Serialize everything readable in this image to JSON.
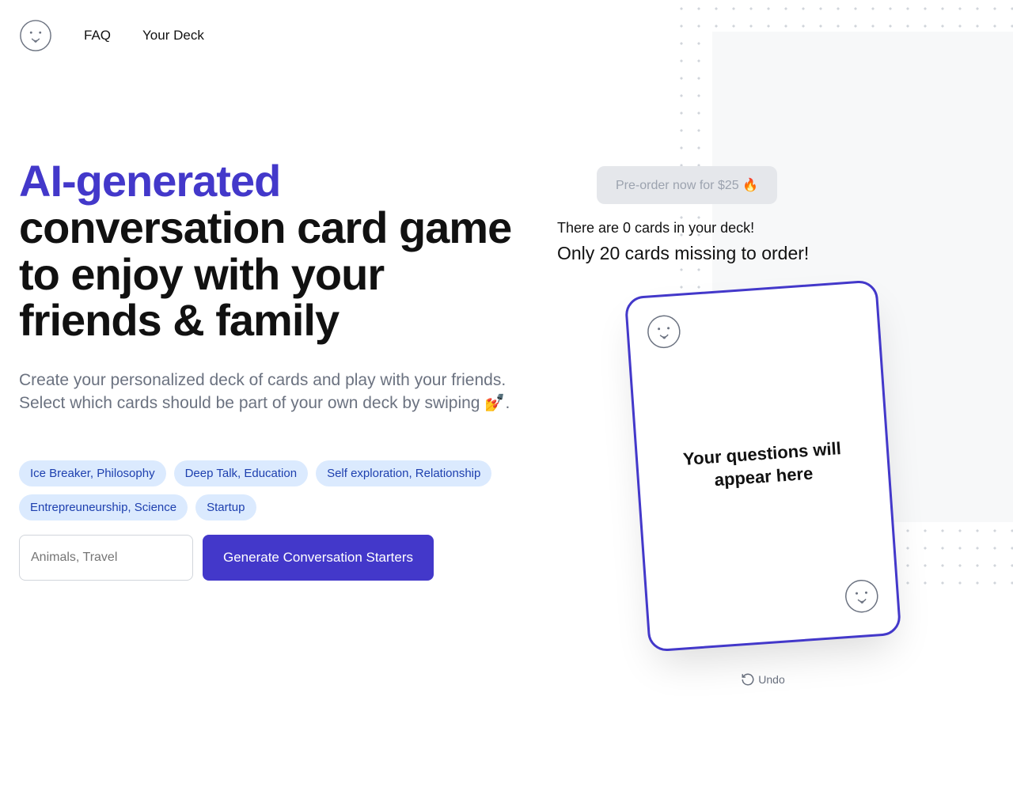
{
  "nav": {
    "faq": "FAQ",
    "your_deck": "Your Deck"
  },
  "hero": {
    "title_highlight": "AI-generated",
    "title_rest": " conversation card game to enjoy with your friends & family",
    "subtitle": "Create your personalized deck of cards and play with your friends. Select which cards should be part of your own deck by swiping 💅."
  },
  "chips": [
    "Ice Breaker, Philosophy",
    "Deep Talk, Education",
    "Self exploration, Relationship",
    "Entrepreuneurship, Science",
    "Startup"
  ],
  "form": {
    "topic_placeholder": "Animals, Travel",
    "generate_label": "Generate Conversation Starters"
  },
  "right": {
    "preorder_label": "Pre-order now for $25 🔥",
    "deck_status": "There are 0 cards in your deck!",
    "deck_missing": "Only 20 cards missing to order!",
    "card_text": "Your questions will appear here",
    "undo_label": "Undo"
  }
}
